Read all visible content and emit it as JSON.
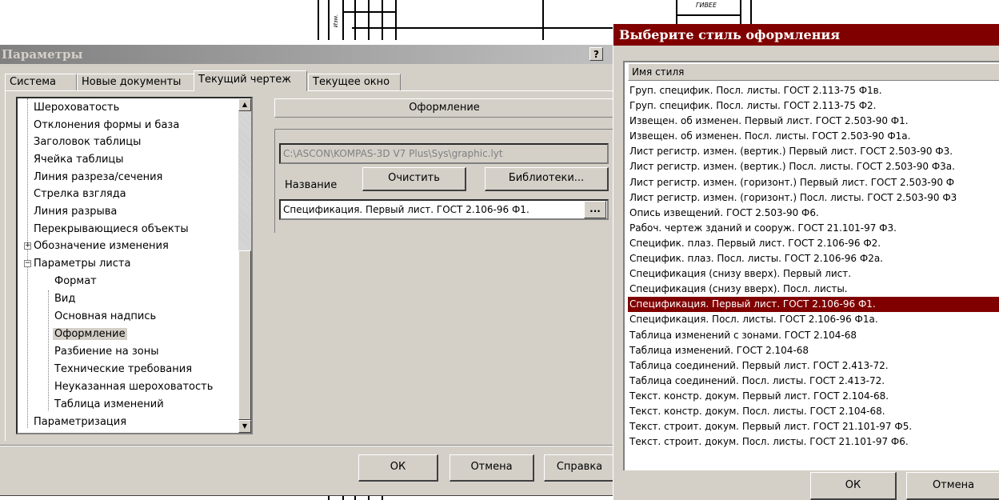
{
  "colors": {
    "dialog_face": "#d4d0c8",
    "selection": "#800000",
    "inactive_title_start": "#808080",
    "inactive_title_end": "#c0c0c0"
  },
  "drawing": {
    "stamp_text": "ГИВЕЕ",
    "side_text": "Изм."
  },
  "params_dialog": {
    "title": "Параметры",
    "help_label": "?",
    "tabs": [
      {
        "label": "Система"
      },
      {
        "label": "Новые документы"
      },
      {
        "label": "Текущий чертеж"
      },
      {
        "label": "Текущее окно"
      }
    ],
    "active_tab": "Текущий чертеж",
    "tree": [
      {
        "label": "Шероховатость"
      },
      {
        "label": "Отклонения формы и база"
      },
      {
        "label": "Заголовок таблицы"
      },
      {
        "label": "Ячейка таблицы"
      },
      {
        "label": "Линия разреза/сечения"
      },
      {
        "label": "Стрелка взгляда"
      },
      {
        "label": "Линия разрыва"
      },
      {
        "label": "Перекрывающиеся объекты"
      },
      {
        "label": "Обозначение изменения"
      },
      {
        "label": "Параметры листа"
      },
      {
        "label": "Формат"
      },
      {
        "label": "Вид"
      },
      {
        "label": "Основная надпись"
      },
      {
        "label": "Оформление"
      },
      {
        "label": "Разбиение на зоны"
      },
      {
        "label": "Технические требования"
      },
      {
        "label": "Неуказанная шероховатость"
      },
      {
        "label": "Таблица изменений"
      },
      {
        "label": "Параметризация"
      }
    ],
    "tree_expanders": {
      "collapsed": "+",
      "expanded": "−"
    },
    "section_header": "Оформление",
    "library_path": "C:\\ASCON\\KOMPAS-3D V7 Plus\\Sys\\graphic.lyt",
    "name_label": "Название",
    "clear_button": "Очистить",
    "libraries_button": "Библиотеки...",
    "name_value": "Спецификация. Первый лист. ГОСТ 2.106-96 Ф1.",
    "browse_button": "...",
    "ok_button": "ОК",
    "cancel_button": "Отмена",
    "help_button": "Справка"
  },
  "style_dialog": {
    "title": "Выберите стиль оформления",
    "column_header": "Имя стиля",
    "selected_index": 14,
    "items": [
      "Груп. специфик. Посл. листы. ГОСТ 2.113-75 Ф1в.",
      "Груп. специфик. Посл. листы. ГОСТ 2.113-75 Ф2.",
      "Извещен. об изменен. Первый лист. ГОСТ 2.503-90 Ф1.",
      "Извещен. об изменен. Посл. листы. ГОСТ 2.503-90 Ф1а.",
      "Лист регистр. измен. (вертик.) Первый лист. ГОСТ 2.503-90 Ф3.",
      "Лист регистр. измен. (вертик.) Посл. листы. ГОСТ 2.503-90 Ф3а.",
      "Лист регистр. измен. (горизонт.) Первый лист. ГОСТ 2.503-90 Ф",
      "Лист регистр. измен. (горизонт.) Посл. листы. ГОСТ 2.503-90 Ф3",
      "Опись извещений. ГОСТ 2.503-90 Ф6.",
      "Рабоч. чертеж зданий и сооруж. ГОСТ 21.101-97 Ф3.",
      "Специфик. плаз. Первый лист. ГОСТ 2.106-96 Ф2.",
      "Специфик. плаз. Посл. листы. ГОСТ 2.106-96 Ф2а.",
      "Спецификация (снизу вверх). Первый лист.",
      "Спецификация (снизу вверх). Посл. листы.",
      "Спецификация. Первый лист. ГОСТ 2.106-96 Ф1.",
      "Спецификация. Посл. листы. ГОСТ 2.106-96 Ф1а.",
      "Таблица изменений с зонами. ГОСТ 2.104-68",
      "Таблица изменений. ГОСТ 2.104-68",
      "Таблица соединений. Первый лист. ГОСТ 2.413-72.",
      "Таблица соединений. Посл. листы. ГОСТ 2.413-72.",
      "Текст. констр. докум. Первый лист. ГОСТ 2.104-68.",
      "Текст. констр. докум. Посл. листы. ГОСТ 2.104-68.",
      "Текст. строит. докум. Первый лист. ГОСТ 21.101-97 Ф5.",
      "Текст. строит. докум. Посл. листы. ГОСТ 21.101-97 Ф6."
    ],
    "ok_button": "ОК",
    "cancel_button": "Отмена"
  }
}
